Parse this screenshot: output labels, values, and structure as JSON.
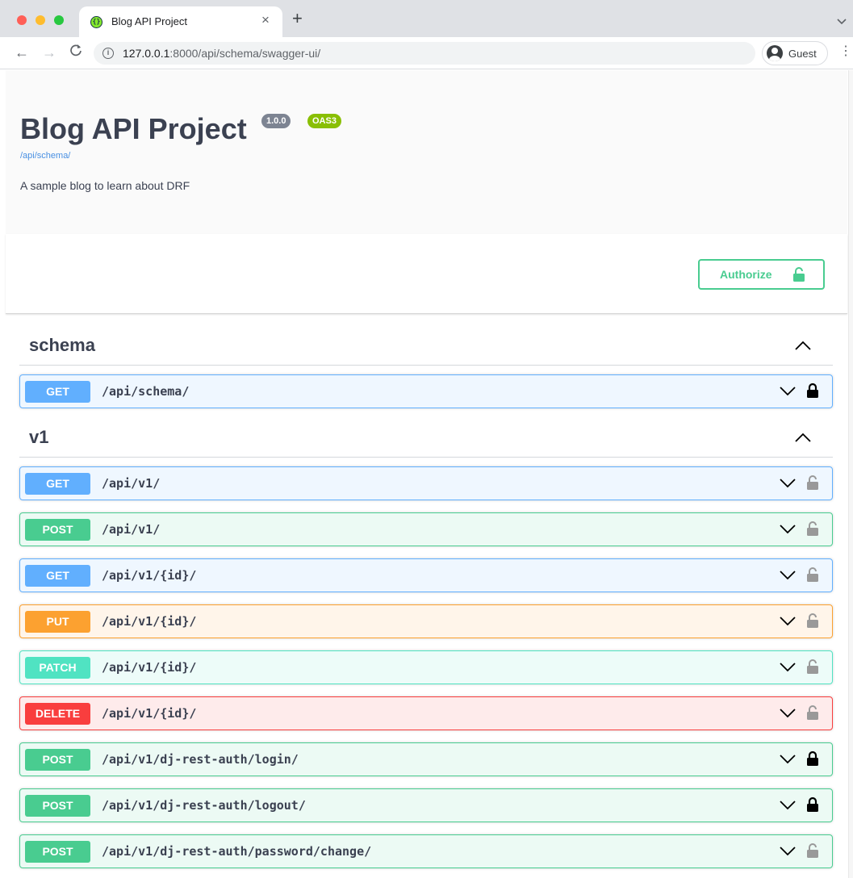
{
  "browser": {
    "tab_title": "Blog API Project",
    "tab_close": "×",
    "new_tab": "+",
    "tabs_menu": "⌄",
    "url_host": "127.0.0.1",
    "url_path": ":8000/api/schema/swagger-ui/",
    "profile_name": "Guest",
    "nav_back": "←",
    "nav_forward": "→",
    "nav_reload": "C",
    "menu": "⋮"
  },
  "info": {
    "title": "Blog API Project",
    "version": "1.0.0",
    "oas_badge": "OAS3",
    "schema_link": "/api/schema/",
    "description": "A sample blog to learn about DRF"
  },
  "authorize": {
    "label": "Authorize"
  },
  "tags": [
    {
      "name": "schema",
      "operations": [
        {
          "method": "GET",
          "path": "/api/schema/",
          "locked": true
        }
      ]
    },
    {
      "name": "v1",
      "operations": [
        {
          "method": "GET",
          "path": "/api/v1/",
          "locked": false
        },
        {
          "method": "POST",
          "path": "/api/v1/",
          "locked": false
        },
        {
          "method": "GET",
          "path": "/api/v1/{id}/",
          "locked": false
        },
        {
          "method": "PUT",
          "path": "/api/v1/{id}/",
          "locked": false
        },
        {
          "method": "PATCH",
          "path": "/api/v1/{id}/",
          "locked": false
        },
        {
          "method": "DELETE",
          "path": "/api/v1/{id}/",
          "locked": false
        },
        {
          "method": "POST",
          "path": "/api/v1/dj-rest-auth/login/",
          "locked": true
        },
        {
          "method": "POST",
          "path": "/api/v1/dj-rest-auth/logout/",
          "locked": true
        },
        {
          "method": "POST",
          "path": "/api/v1/dj-rest-auth/password/change/",
          "locked": false
        }
      ]
    }
  ],
  "colors": {
    "get": "#61affe",
    "post": "#49cc90",
    "put": "#fca130",
    "patch": "#50e3c2",
    "delete": "#f93e3e",
    "authorize": "#49cc90",
    "version_badge": "#7d8492",
    "oas_badge": "#89bf04"
  },
  "icons": {
    "lock_locked": "lock-closed-icon",
    "lock_unlocked": "lock-open-icon",
    "expand": "chevron-down-icon",
    "collapse": "chevron-up-icon"
  }
}
